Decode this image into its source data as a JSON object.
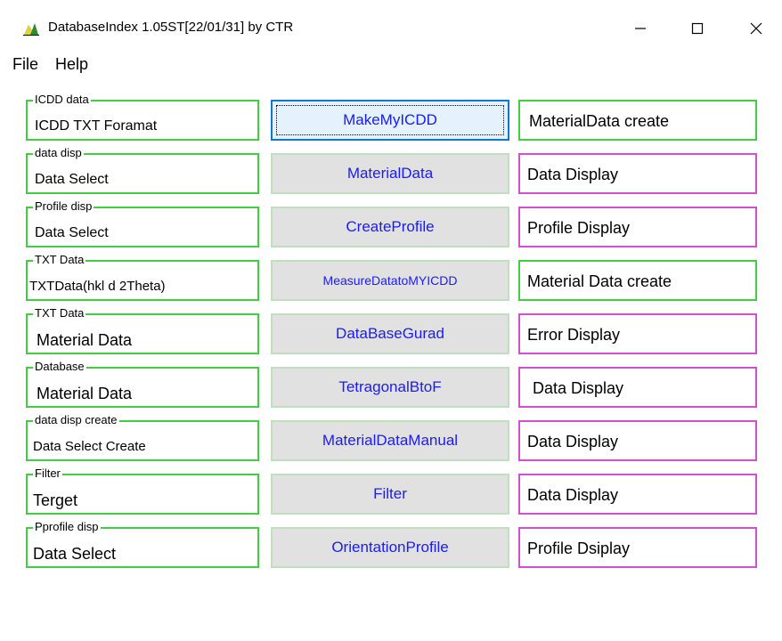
{
  "window": {
    "title": "DatabaseIndex 1.05ST[22/01/31] by CTR",
    "controls": [
      "minimize-icon",
      "maximize-icon",
      "close-icon"
    ]
  },
  "menu": [
    "File",
    "Help"
  ],
  "colors": {
    "group_border": "#3fcf3f",
    "output_green": "#3fcf3f",
    "output_magenta": "#d24fd2",
    "button_text": "#1a1aff",
    "button_bg": "#e1e1e1"
  },
  "rows": [
    {
      "group": "ICDD data",
      "input": "ICDD TXT Foramat",
      "button": "MakeMyICDD",
      "output": "MaterialData create",
      "output_color": "green"
    },
    {
      "group": "data disp",
      "input": "Data Select",
      "button": "MaterialData",
      "output": "Data Display",
      "output_color": "magenta"
    },
    {
      "group": "Profile disp",
      "input": "Data Select",
      "button": "CreateProfile",
      "output": "Profile Display",
      "output_color": "magenta"
    },
    {
      "group": "TXT Data",
      "input": "TXTData(hkl d 2Theta)",
      "button": "MeasureDatatoMYICDD",
      "output": "Material Data create",
      "output_color": "green"
    },
    {
      "group": "TXT Data",
      "input": "Material Data",
      "button": "DataBaseGurad",
      "output": "Error Display",
      "output_color": "magenta"
    },
    {
      "group": "Database",
      "input": "Material Data",
      "button": "TetragonalBtoF",
      "output": "Data Display",
      "output_color": "magenta"
    },
    {
      "group": "data disp create",
      "input": "Data Select Create",
      "button": "MaterialDataManual",
      "output": "Data Display",
      "output_color": "magenta"
    },
    {
      "group": "Filter",
      "input": "Terget",
      "button": "Filter",
      "output": "Data Display",
      "output_color": "magenta"
    },
    {
      "group": "Pprofile disp",
      "input": "Data Select",
      "button": "OrientationProfile",
      "output": "Profile Dsiplay",
      "output_color": "magenta"
    }
  ]
}
